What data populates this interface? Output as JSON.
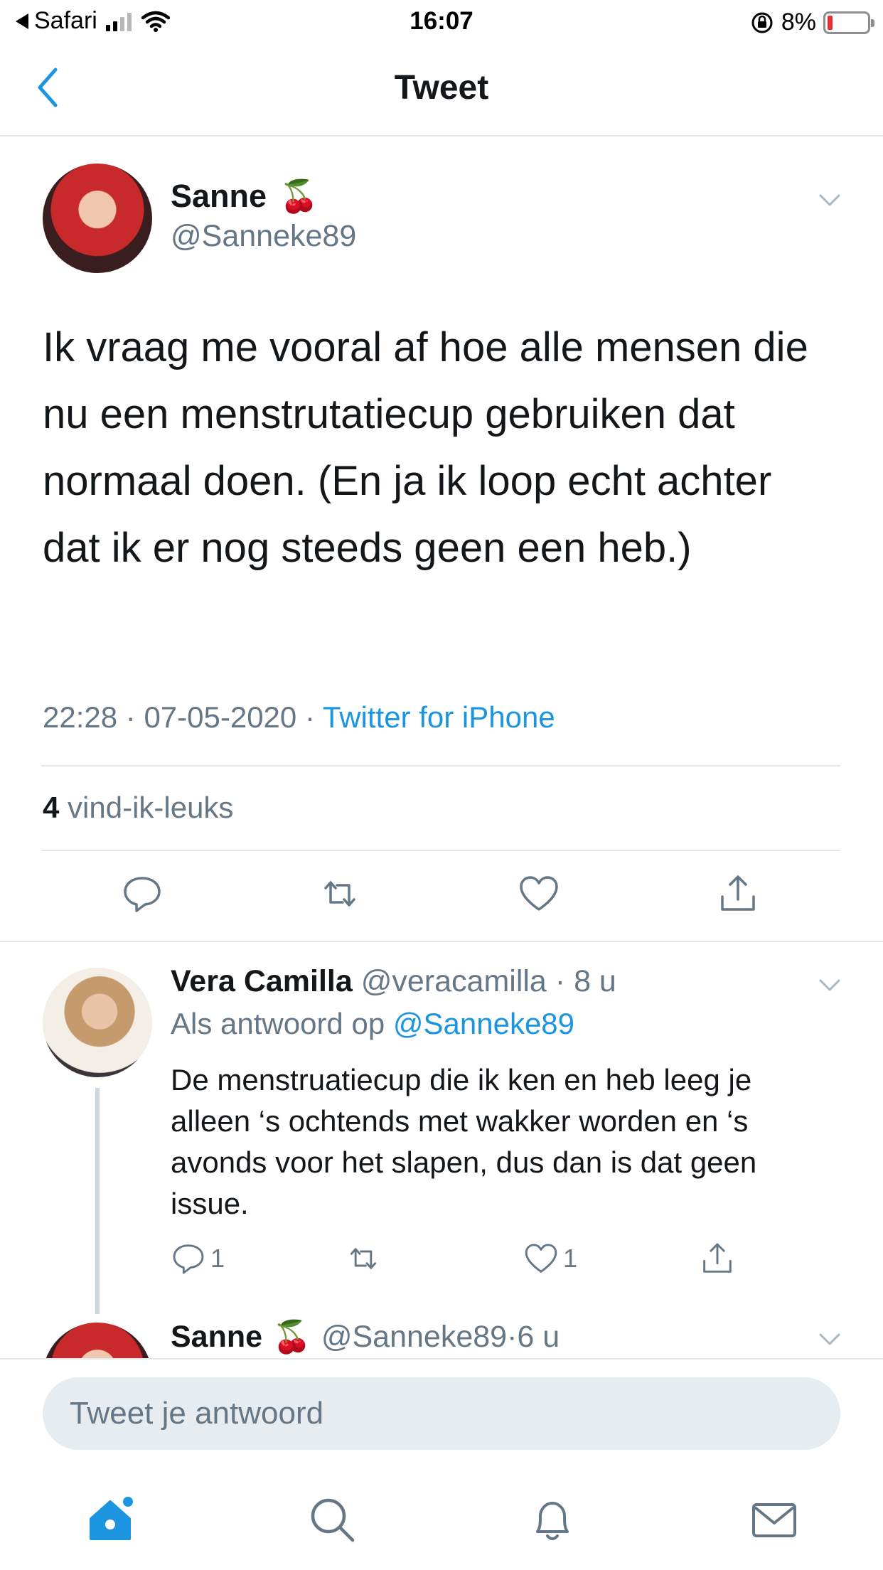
{
  "status_bar": {
    "back_app": "Safari",
    "time": "16:07",
    "battery_percent": "8%",
    "battery_level": 0.08,
    "battery_color": "#e8302f"
  },
  "nav": {
    "title": "Tweet",
    "back_icon": "chevron-left-icon"
  },
  "main_tweet": {
    "author_name": "Sanne",
    "author_emoji": "🍒",
    "handle": "@Sanneke89",
    "text": "Ik vraag me vooral af hoe alle mensen die nu een menstrutatiecup gebruiken dat normaal doen. (En ja ik loop echt achter dat ik er nog steeds geen een heb.)",
    "time": "22:28",
    "date": "07-05-2020",
    "separator": " · ",
    "source": "Twitter for iPhone",
    "likes_count": "4",
    "likes_label": "vind-ik-leuks",
    "actions": [
      "reply-icon",
      "retweet-icon",
      "like-icon",
      "share-icon"
    ]
  },
  "reply": {
    "author_name": "Vera Camilla",
    "handle": "@veracamilla",
    "time": "8 u",
    "reply_prefix": "Als antwoord op",
    "reply_to": "@Sanneke89",
    "text": "De menstruatiecup die ik ken en heb leeg je alleen ‘s ochtends met wakker worden en ‘s avonds voor het slapen, dus dan is dat geen issue.",
    "reply_count": "1",
    "like_count": "1"
  },
  "second_reply": {
    "author_name": "Sanne",
    "author_emoji": "🍒",
    "handle": "@Sanneke89",
    "time": "6 u"
  },
  "composer": {
    "placeholder": "Tweet je antwoord"
  },
  "tab_bar": {
    "items": [
      "home-icon",
      "search-icon",
      "notifications-icon",
      "messages-icon"
    ],
    "active": "home-icon"
  },
  "colors": {
    "accent": "#1b95e0",
    "secondary_text": "#657786",
    "divider": "#e1e8ed",
    "input_bg": "#e6ecf0"
  }
}
